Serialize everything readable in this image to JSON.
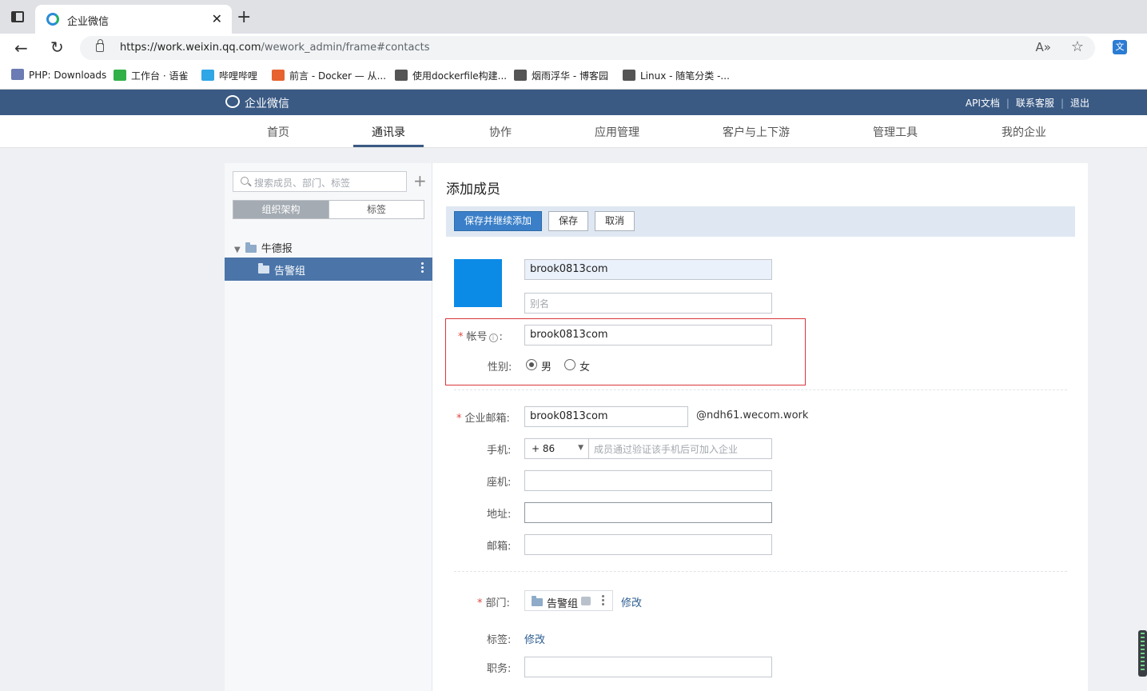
{
  "browser": {
    "tab_title": "企业微信",
    "tab_close": "✕",
    "new_tab": "+",
    "url_host": "https://work.weixin.qq.com",
    "url_path": "/wework_admin/frame#contacts",
    "bookmarks": [
      {
        "label": "PHP: Downloads",
        "icon_color": "#6b7bb3"
      },
      {
        "label": "工作台 · 语雀",
        "icon_color": "#31b048"
      },
      {
        "label": "哔哩哔哩",
        "icon_color": "#2fa6e6"
      },
      {
        "label": "前言 - Docker — 从...",
        "icon_color": "#e6622f"
      },
      {
        "label": "使用dockerfile构建...",
        "icon_color": "#555555"
      },
      {
        "label": "烟雨浮华 - 博客园",
        "icon_color": "#555555"
      },
      {
        "label": "Linux - 随笔分类 -...",
        "icon_color": "#555555"
      }
    ]
  },
  "header": {
    "logo_text": "企业微信",
    "links": [
      "API文档",
      "联系客服",
      "退出"
    ]
  },
  "nav": {
    "items": [
      "首页",
      "通讯录",
      "协作",
      "应用管理",
      "客户与上下游",
      "管理工具",
      "我的企业"
    ],
    "active": "通讯录"
  },
  "sidebar": {
    "search_placeholder": "搜索成员、部门、标签",
    "tabs": [
      "组织架构",
      "标签"
    ],
    "root": "牛德报",
    "child": "告警组"
  },
  "form": {
    "title": "添加成员",
    "buttons": {
      "save_continue": "保存并继续添加",
      "save": "保存",
      "cancel": "取消"
    },
    "name_value": "brook0813com",
    "alias_placeholder": "别名",
    "account_label": "帐号",
    "account_value": "brook0813com",
    "gender_label": "性别:",
    "gender_options": [
      "男",
      "女"
    ],
    "gender_selected": "男",
    "email_label": "企业邮箱:",
    "email_value": "brook0813com",
    "email_suffix": "@ndh61.wecom.work",
    "mobile_label": "手机:",
    "country_code": "+ 86",
    "mobile_placeholder": "成员通过验证该手机后可加入企业",
    "landline_label": "座机:",
    "address_label": "地址:",
    "personal_email_label": "邮箱:",
    "dept_label": "部门:",
    "dept_value": "告警组",
    "dept_edit": "修改",
    "tag_label": "标签:",
    "tag_edit": "修改",
    "position_label": "职务:"
  },
  "colors": {
    "header_bg": "#3a5a84",
    "primary_button": "#3a7fc8",
    "avatar": "#0c8be6",
    "selected_tree": "#4b75a9",
    "required": "#e0463c",
    "highlight_border": "#d9373d"
  }
}
